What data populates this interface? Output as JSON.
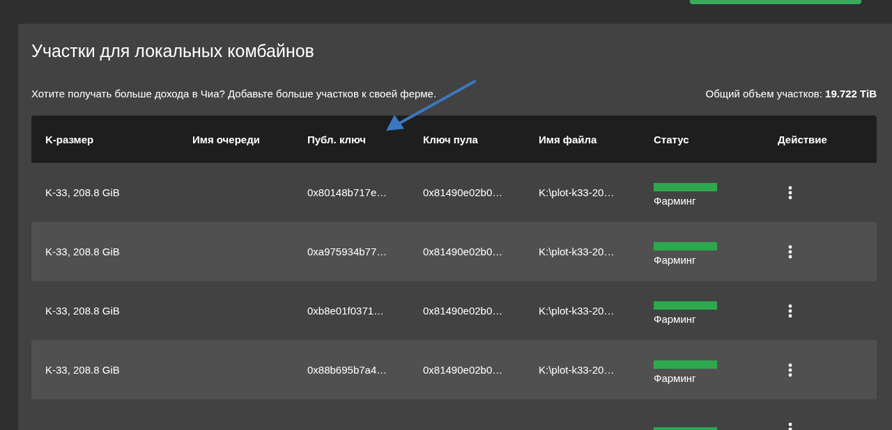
{
  "card": {
    "title": "Участки для локальных комбайнов",
    "hint": "Хотите получать больше дохода в Чиа? Добавьте больше участков к своей ферме.",
    "total_label": "Общий объем участков:",
    "total_value": "19.722 TiB"
  },
  "table": {
    "columns": [
      "K-размер",
      "Имя очереди",
      "Публ. ключ",
      "Ключ пула",
      "Имя файла",
      "Статус",
      "Действие"
    ],
    "rows": [
      {
        "size": "K-33, 208.8 GiB",
        "public_key": "0x80148b717e…",
        "pool_key": "0x81490e02b0…",
        "file": "K:\\plot-k33-20…",
        "status": "Фарминг",
        "color": "#2ea84f"
      },
      {
        "size": "K-33, 208.8 GiB",
        "public_key": "0xa975934b77…",
        "pool_key": "0x81490e02b0…",
        "file": "K:\\plot-k33-20…",
        "status": "Фарминг",
        "color": "#2ea84f"
      },
      {
        "size": "K-33, 208.8 GiB",
        "public_key": "0xb8e01f0371…",
        "pool_key": "0x81490e02b0…",
        "file": "K:\\plot-k33-20…",
        "status": "Фарминг",
        "color": "#2ea84f"
      },
      {
        "size": "K-33, 208.8 GiB",
        "public_key": "0x88b695b7a4…",
        "pool_key": "0x81490e02b0…",
        "file": "K:\\plot-k33-20…",
        "status": "Фарминг",
        "color": "#2ea84f"
      },
      {
        "color": "#2ea84f"
      }
    ]
  }
}
